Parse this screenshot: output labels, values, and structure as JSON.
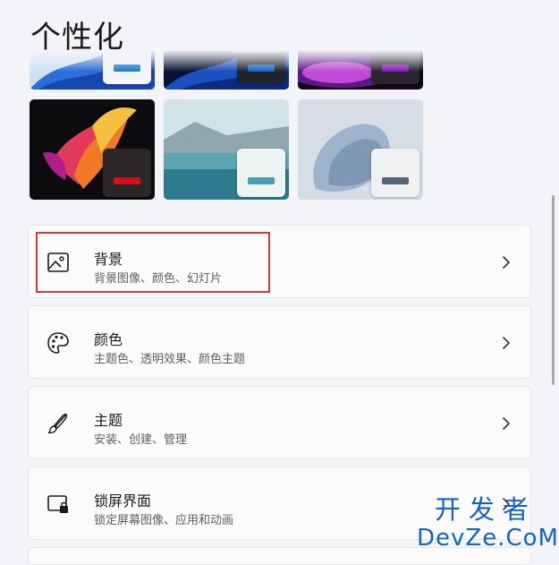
{
  "page": {
    "title": "个性化"
  },
  "themes": [
    {
      "name": "theme-blue-flow",
      "accent": "#1a78d4"
    },
    {
      "name": "theme-dark-blue-flow",
      "accent": "#1866c0"
    },
    {
      "name": "theme-purple-glow",
      "accent": "#8a1bb8"
    },
    {
      "name": "theme-captured-motion",
      "accent": "#d0101c"
    },
    {
      "name": "theme-glow-lake",
      "accent": "#4a9eb0"
    },
    {
      "name": "theme-sunrise-bloom",
      "accent": "#586775"
    }
  ],
  "settings": [
    {
      "id": "background",
      "icon": "image-icon",
      "title": "背景",
      "subtitle": "背景图像、颜色、幻灯片",
      "highlighted": true
    },
    {
      "id": "colors",
      "icon": "palette-icon",
      "title": "颜色",
      "subtitle": "主题色、透明效果、颜色主题"
    },
    {
      "id": "themes",
      "icon": "brush-icon",
      "title": "主题",
      "subtitle": "安装、创建、管理"
    },
    {
      "id": "lock-screen",
      "icon": "lock-screen-icon",
      "title": "锁屏界面",
      "subtitle": "锁定屏幕图像、应用和动画"
    }
  ],
  "watermark": {
    "line1": "开发者",
    "line2": "DevZe.CoM"
  },
  "colors": {
    "highlight_border": "#d63b3b",
    "watermark": "#1565c0"
  }
}
